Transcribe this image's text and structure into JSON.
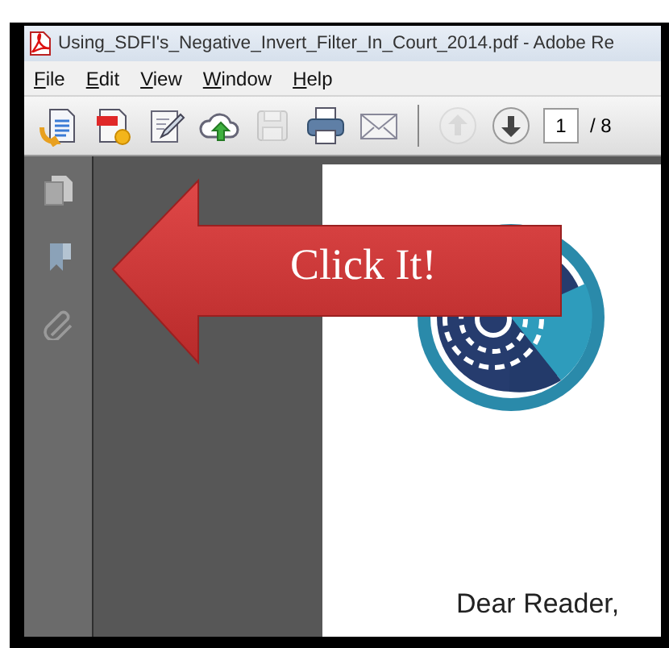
{
  "window": {
    "title": "Using_SDFI's_Negative_Invert_Filter_In_Court_2014.pdf - Adobe Re"
  },
  "menu": [
    {
      "label": "File"
    },
    {
      "label": "Edit"
    },
    {
      "label": "View"
    },
    {
      "label": "Window"
    },
    {
      "label": "Help"
    }
  ],
  "toolbar": [
    {
      "kind": "create",
      "disabled": false
    },
    {
      "kind": "combine",
      "disabled": false
    },
    {
      "kind": "sign",
      "disabled": false
    },
    {
      "kind": "upload",
      "disabled": false
    },
    {
      "kind": "save",
      "disabled": true
    },
    {
      "kind": "print",
      "disabled": false
    },
    {
      "kind": "email",
      "disabled": false
    },
    {
      "kind": "separator"
    },
    {
      "kind": "prev",
      "disabled": true
    },
    {
      "kind": "next",
      "disabled": false
    }
  ],
  "page_field": {
    "value": "1"
  },
  "page_total": "/ 8",
  "sidebar": [
    {
      "kind": "pages"
    },
    {
      "kind": "bookmarks"
    },
    {
      "kind": "attachments"
    }
  ],
  "document": {
    "greeting": "Dear Reader,"
  },
  "callout": {
    "text": "Click It!"
  }
}
